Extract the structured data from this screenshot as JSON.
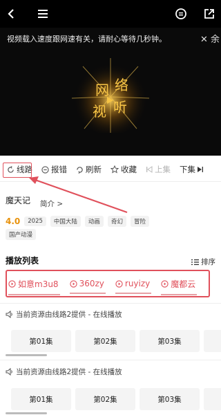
{
  "topbar": {
    "icons": [
      "back-arrow-icon",
      "menu-icon",
      "chat-icon",
      "share-icon"
    ]
  },
  "video": {
    "notice": "视频载入速度跟网速有关，请耐心等待几秒钟。",
    "close_text": "✕ 余",
    "logo_chars": [
      "网",
      "络",
      "视",
      "听"
    ]
  },
  "toolbar": {
    "route": "线路",
    "report": "报错",
    "refresh": "刷新",
    "favorite": "收藏",
    "prev": "上集",
    "next": "下集"
  },
  "info": {
    "title": "魔天记",
    "intro": "简介 >",
    "rating": "4.0",
    "tags": [
      "2025",
      "中国大陆",
      "动画",
      "奇幻",
      "冒险"
    ],
    "tag_row2": "国产动漫"
  },
  "playlist": {
    "title": "播放列表",
    "sort": "排序",
    "sources": [
      "如意m3u8",
      "360zy",
      "ruyizy",
      "魔都云"
    ],
    "sections": [
      {
        "provider": "当前资源由线路2提供 - 在线播放",
        "episodes": [
          "第01集",
          "第02集",
          "第03集"
        ]
      },
      {
        "provider": "当前资源由线路2提供 - 在线播放",
        "episodes": [
          "第01集",
          "第02集",
          "第03集"
        ]
      }
    ]
  },
  "colors": {
    "accent": "#e0505b",
    "rating": "#e8920c",
    "logo": "#f0b030"
  }
}
